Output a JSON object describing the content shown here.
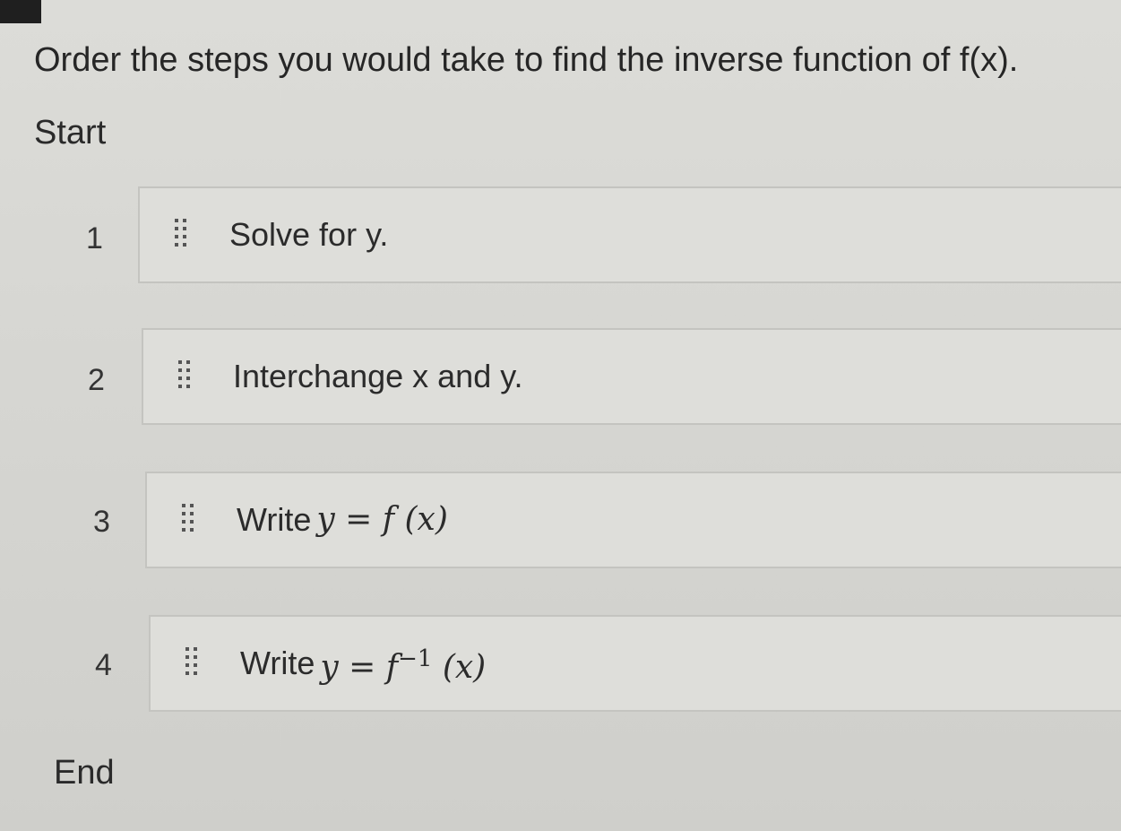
{
  "question": {
    "prompt": "Order the steps you would take to find the inverse function of f(x).",
    "start_label": "Start",
    "end_label": "End"
  },
  "steps": [
    {
      "number": "1",
      "text": "Solve for y.",
      "math": "",
      "math_sup": "",
      "math_tail": ""
    },
    {
      "number": "2",
      "text": "Interchange x and y.",
      "math": "",
      "math_sup": "",
      "math_tail": ""
    },
    {
      "number": "3",
      "text": "Write",
      "math": "y = f (x)",
      "math_sup": "",
      "math_tail": ""
    },
    {
      "number": "4",
      "text": "Write",
      "math": "y = f",
      "math_sup": "−1",
      "math_tail": " (x)"
    }
  ],
  "icons": {
    "drag_handle": "drag-handle-icon"
  }
}
